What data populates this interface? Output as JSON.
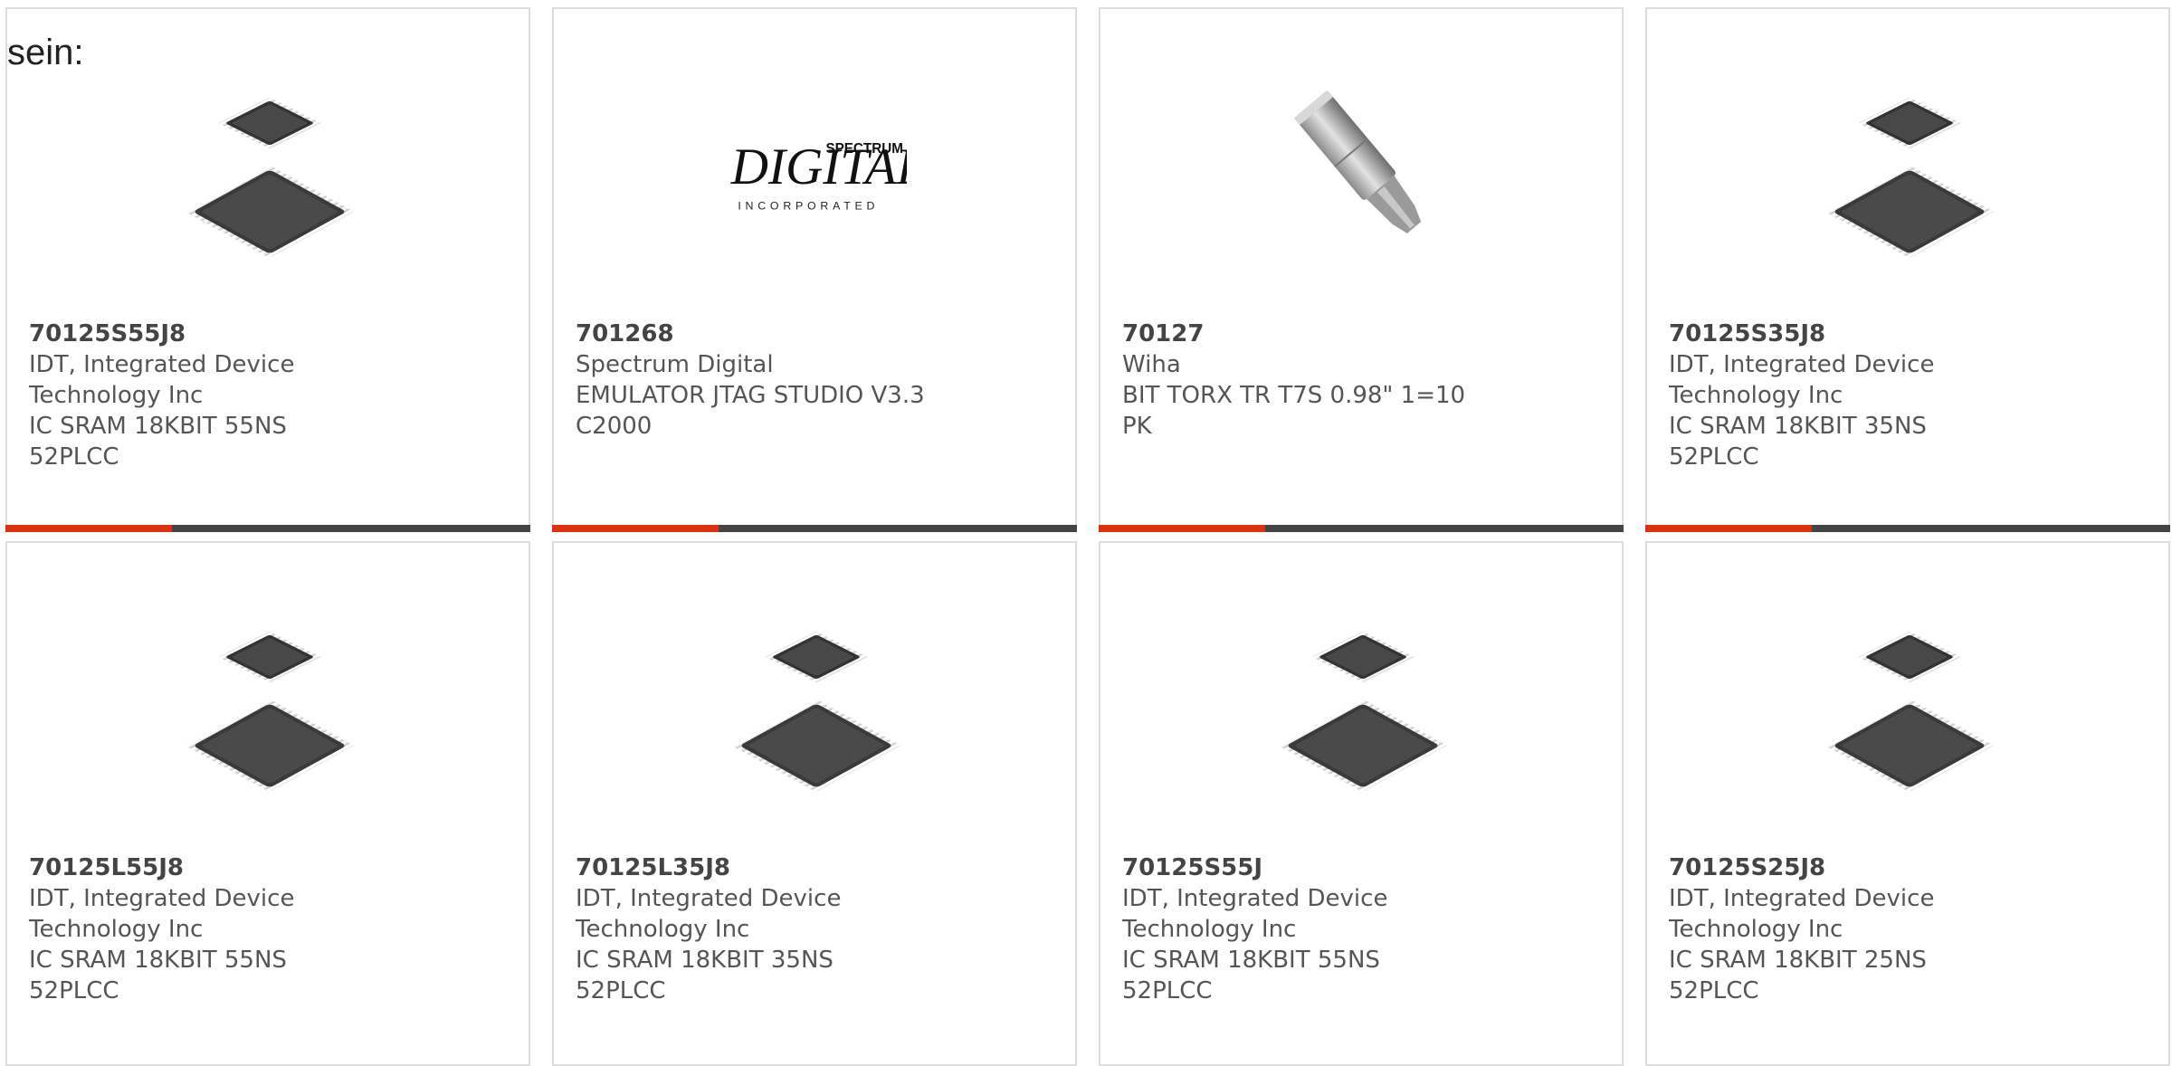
{
  "intro_text": "sein:",
  "colors": {
    "accent": "#d9330f",
    "bar": "#444444",
    "border": "#dedede"
  },
  "products": [
    {
      "part": "70125S55J8",
      "manufacturer": "IDT, Integrated Device Technology Inc",
      "description": "IC SRAM 18KBIT 55NS 52PLCC",
      "image": "plcc-chip-icon"
    },
    {
      "part": "701268",
      "manufacturer": "Spectrum Digital",
      "description": "EMULATOR JTAG STUDIO V3.3 C2000",
      "image": "spectrum-digital-logo",
      "logo_top": "SPECTRUM",
      "logo_main": "DIGITAL",
      "logo_bottom": "INCORPORATED"
    },
    {
      "part": "70127",
      "manufacturer": "Wiha",
      "description": "BIT TORX TR T7S 0.98\" 1=10 PK",
      "image": "torx-bit-icon"
    },
    {
      "part": "70125S35J8",
      "manufacturer": "IDT, Integrated Device Technology Inc",
      "description": "IC SRAM 18KBIT 35NS 52PLCC",
      "image": "plcc-chip-icon"
    },
    {
      "part": "70125L55J8",
      "manufacturer": "IDT, Integrated Device Technology Inc",
      "description": "IC SRAM 18KBIT 55NS 52PLCC",
      "image": "plcc-chip-icon"
    },
    {
      "part": "70125L35J8",
      "manufacturer": "IDT, Integrated Device Technology Inc",
      "description": "IC SRAM 18KBIT 35NS 52PLCC",
      "image": "plcc-chip-icon"
    },
    {
      "part": "70125S55J",
      "manufacturer": "IDT, Integrated Device Technology Inc",
      "description": "IC SRAM 18KBIT 55NS 52PLCC",
      "image": "plcc-chip-icon"
    },
    {
      "part": "70125S25J8",
      "manufacturer": "IDT, Integrated Device Technology Inc",
      "description": "IC SRAM 18KBIT 25NS 52PLCC",
      "image": "plcc-chip-icon"
    }
  ]
}
